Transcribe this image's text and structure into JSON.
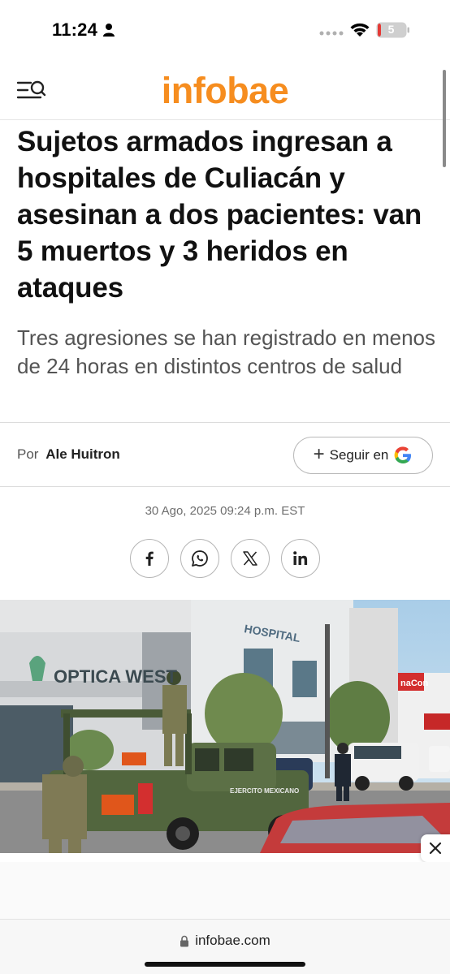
{
  "status_bar": {
    "time": "11:24",
    "battery": "5"
  },
  "header": {
    "logo": "infobae",
    "menu_icon": "menu-search-icon",
    "brand_color": "#f68d1f"
  },
  "article": {
    "title": "Sujetos armados ingresan a hospitales de Culiacán y asesinan a dos pacientes: van 5 muertos y 3 heridos en ataques",
    "subtitle": "Tres agresiones se han registrado en menos de 24 horas en distintos centros de salud",
    "byline_prefix": "Por",
    "author": "Ale Huitron",
    "follow_label": "Seguir en",
    "date": "30 Ago, 2025 09:24 p.m. EST"
  },
  "share": {
    "facebook": "facebook-icon",
    "whatsapp": "whatsapp-icon",
    "x": "x-icon",
    "linkedin": "linkedin-icon"
  },
  "photo": {
    "sign_optica": "OPTICA WEST",
    "sign_hospital": "HOSPITAL",
    "truck_text": "EJERCITO MEXICANO",
    "sign_right": "naCon"
  },
  "browser": {
    "url": "infobae.com"
  }
}
